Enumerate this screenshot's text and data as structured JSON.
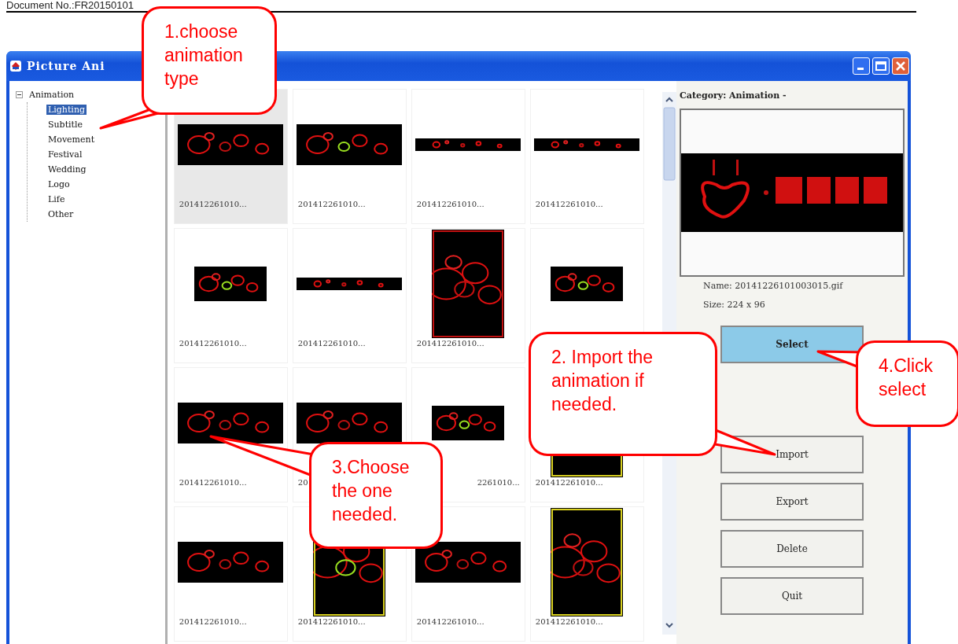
{
  "document": {
    "header": "Document No.:FR20150101"
  },
  "window": {
    "title": "Picture Ani"
  },
  "tree": {
    "label": "Animation",
    "expanded": true,
    "children": [
      {
        "label": "Lighting",
        "selected": true
      },
      {
        "label": "Subtitle",
        "selected": false
      },
      {
        "label": "Movement",
        "selected": false
      },
      {
        "label": "Festival",
        "selected": false
      },
      {
        "label": "Wedding",
        "selected": false
      },
      {
        "label": "Logo",
        "selected": false
      },
      {
        "label": "Life",
        "selected": false
      },
      {
        "label": "Other",
        "selected": false
      }
    ]
  },
  "thumbnails": [
    {
      "label": "201412261010...",
      "selected": true
    },
    {
      "label": "201412261010...",
      "selected": false
    },
    {
      "label": "201412261010...",
      "selected": false
    },
    {
      "label": "201412261010...",
      "selected": false
    },
    {
      "label": "201412261010...",
      "selected": false
    },
    {
      "label": "201412261010...",
      "selected": false
    },
    {
      "label": "201412261010...",
      "selected": false
    },
    {
      "selected": false
    },
    {
      "label": "201412261010...",
      "selected": false
    },
    {
      "label": "20",
      "selected": false
    },
    {
      "label": "2261010...",
      "selected": false
    },
    {
      "label": "201412261010...",
      "selected": false
    },
    {
      "label": "201412261010...",
      "selected": false
    },
    {
      "label": "201412261010...",
      "selected": false
    },
    {
      "label": "201412261010...",
      "selected": false
    },
    {
      "label": "201412261010...",
      "selected": false
    }
  ],
  "details": {
    "category": "Category: Animation -",
    "name": "Name: 20141226101003015.gif",
    "size": "Size: 224 x 96"
  },
  "buttons": [
    {
      "label": "Select",
      "highlighted": true
    },
    {
      "label": "Import",
      "highlighted": false
    },
    {
      "label": "Export",
      "highlighted": false
    },
    {
      "label": "Delete",
      "highlighted": false
    },
    {
      "label": "Quit",
      "highlighted": false
    }
  ],
  "callouts": [
    {
      "text": "1.choose animation type"
    },
    {
      "text": "2. Import the animation if needed."
    },
    {
      "text": "3.Choose the one needed."
    },
    {
      "text": "4.Click select"
    }
  ]
}
